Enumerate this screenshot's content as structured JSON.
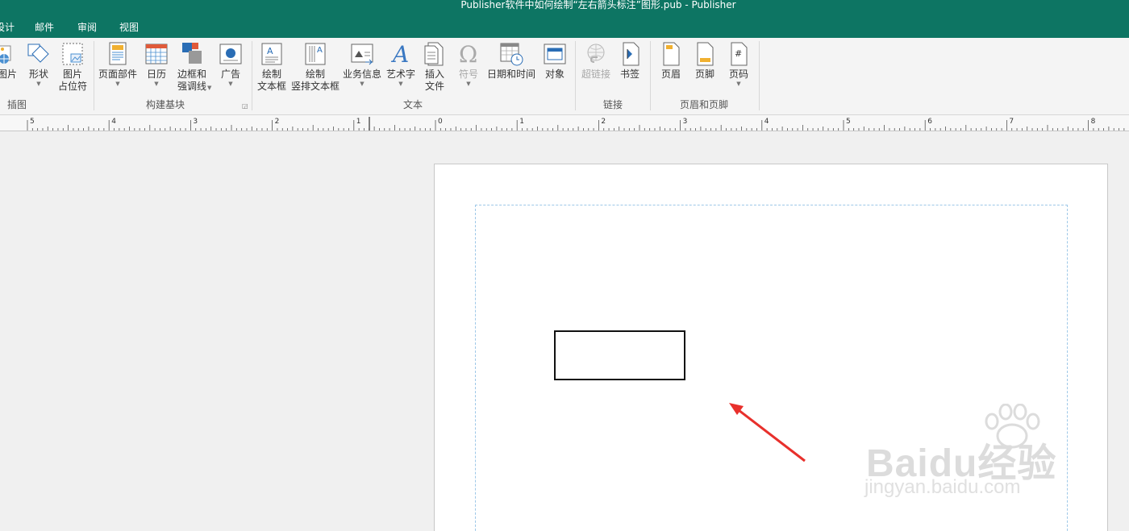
{
  "window": {
    "title": "Publisher软件中如何绘制“左右箭头标注”图形.pub - Publisher"
  },
  "tabs": [
    "设计",
    "邮件",
    "审阅",
    "视图"
  ],
  "ribbon": {
    "groups": [
      {
        "name": "插图",
        "buttons": [
          {
            "label": "图片",
            "icon": "picture-icon"
          },
          {
            "label": "形状",
            "icon": "shapes-icon",
            "dropdown": true
          },
          {
            "label": "图片\n占位符",
            "icon": "picture-placeholder-icon"
          }
        ]
      },
      {
        "name": "构建基块",
        "buttons": [
          {
            "label": "页面部件",
            "icon": "page-parts-icon",
            "dropdown": true
          },
          {
            "label": "日历",
            "icon": "calendar-icon",
            "dropdown": true
          },
          {
            "label": "边框和\n强调线",
            "icon": "borders-accents-icon",
            "dropdown": true
          },
          {
            "label": "广告",
            "icon": "advertisement-icon",
            "dropdown": true
          }
        ]
      },
      {
        "name": "文本",
        "buttons": [
          {
            "label": "绘制\n文本框",
            "icon": "draw-textbox-icon"
          },
          {
            "label": "绘制\n竖排文本框",
            "icon": "draw-vertical-textbox-icon"
          },
          {
            "label": "业务信息",
            "icon": "business-info-icon",
            "dropdown": true
          },
          {
            "label": "艺术字",
            "icon": "wordart-icon",
            "dropdown": true
          },
          {
            "label": "插入\n文件",
            "icon": "insert-file-icon"
          },
          {
            "label": "符号",
            "icon": "symbol-icon",
            "dropdown": true,
            "disabled": true
          },
          {
            "label": "日期和时间",
            "icon": "date-time-icon"
          },
          {
            "label": "对象",
            "icon": "object-icon"
          }
        ]
      },
      {
        "name": "链接",
        "buttons": [
          {
            "label": "超链接",
            "icon": "hyperlink-icon",
            "disabled": true
          },
          {
            "label": "书签",
            "icon": "bookmark-icon"
          }
        ]
      },
      {
        "name": "页眉和页脚",
        "buttons": [
          {
            "label": "页眉",
            "icon": "header-icon"
          },
          {
            "label": "页脚",
            "icon": "footer-icon"
          },
          {
            "label": "页码",
            "icon": "page-number-icon",
            "dropdown": true
          }
        ]
      }
    ]
  },
  "ruler": {
    "labels": [
      "5",
      "4",
      "3",
      "2",
      "1",
      "0",
      "1",
      "2",
      "3",
      "4",
      "5",
      "6",
      "7",
      "8"
    ]
  },
  "watermark": {
    "brand": "Baidu经验",
    "url": "jingyan.baidu.com"
  },
  "colors": {
    "titlebar": "#0d7563",
    "arrow": "#e8302c",
    "guide": "#9ec8e8"
  }
}
